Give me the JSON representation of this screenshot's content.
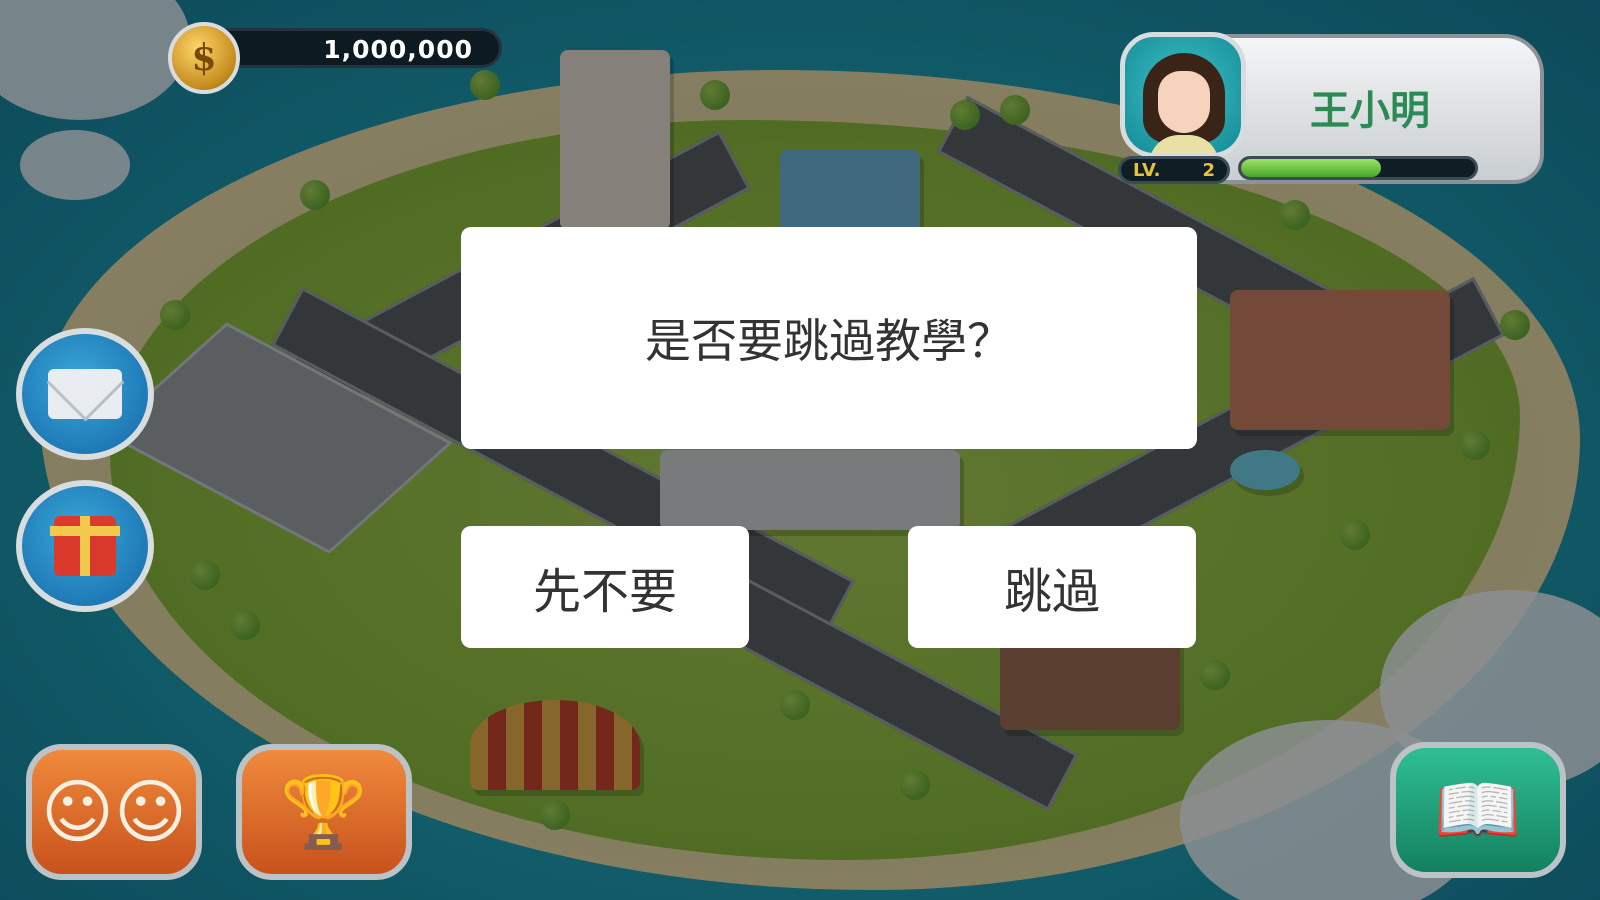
{
  "hud": {
    "coins": "1,000,000",
    "coin_symbol": "$"
  },
  "player": {
    "name": "王小明",
    "level_label": "LV.",
    "level": "2",
    "xp_fraction": 0.6
  },
  "side_buttons": [
    {
      "name": "mail",
      "icon": "envelope-icon"
    },
    {
      "name": "gift",
      "icon": "gift-icon"
    }
  ],
  "bottom_buttons": [
    {
      "name": "friends",
      "icon": "friends-icon",
      "glyph": "☺☺"
    },
    {
      "name": "trophy",
      "icon": "trophy-icon",
      "glyph": "🏆"
    },
    {
      "name": "book",
      "icon": "book-icon",
      "glyph": "📖"
    }
  ],
  "dialog": {
    "message": "是否要跳過教學？",
    "cancel_label": "先不要",
    "confirm_label": "跳過"
  },
  "colors": {
    "dialog_bg": "#ffffff",
    "dialog_text": "#333333",
    "player_name": "#2c8a55",
    "level_text": "#e8c23a",
    "xp_bar": "#47a52a"
  }
}
